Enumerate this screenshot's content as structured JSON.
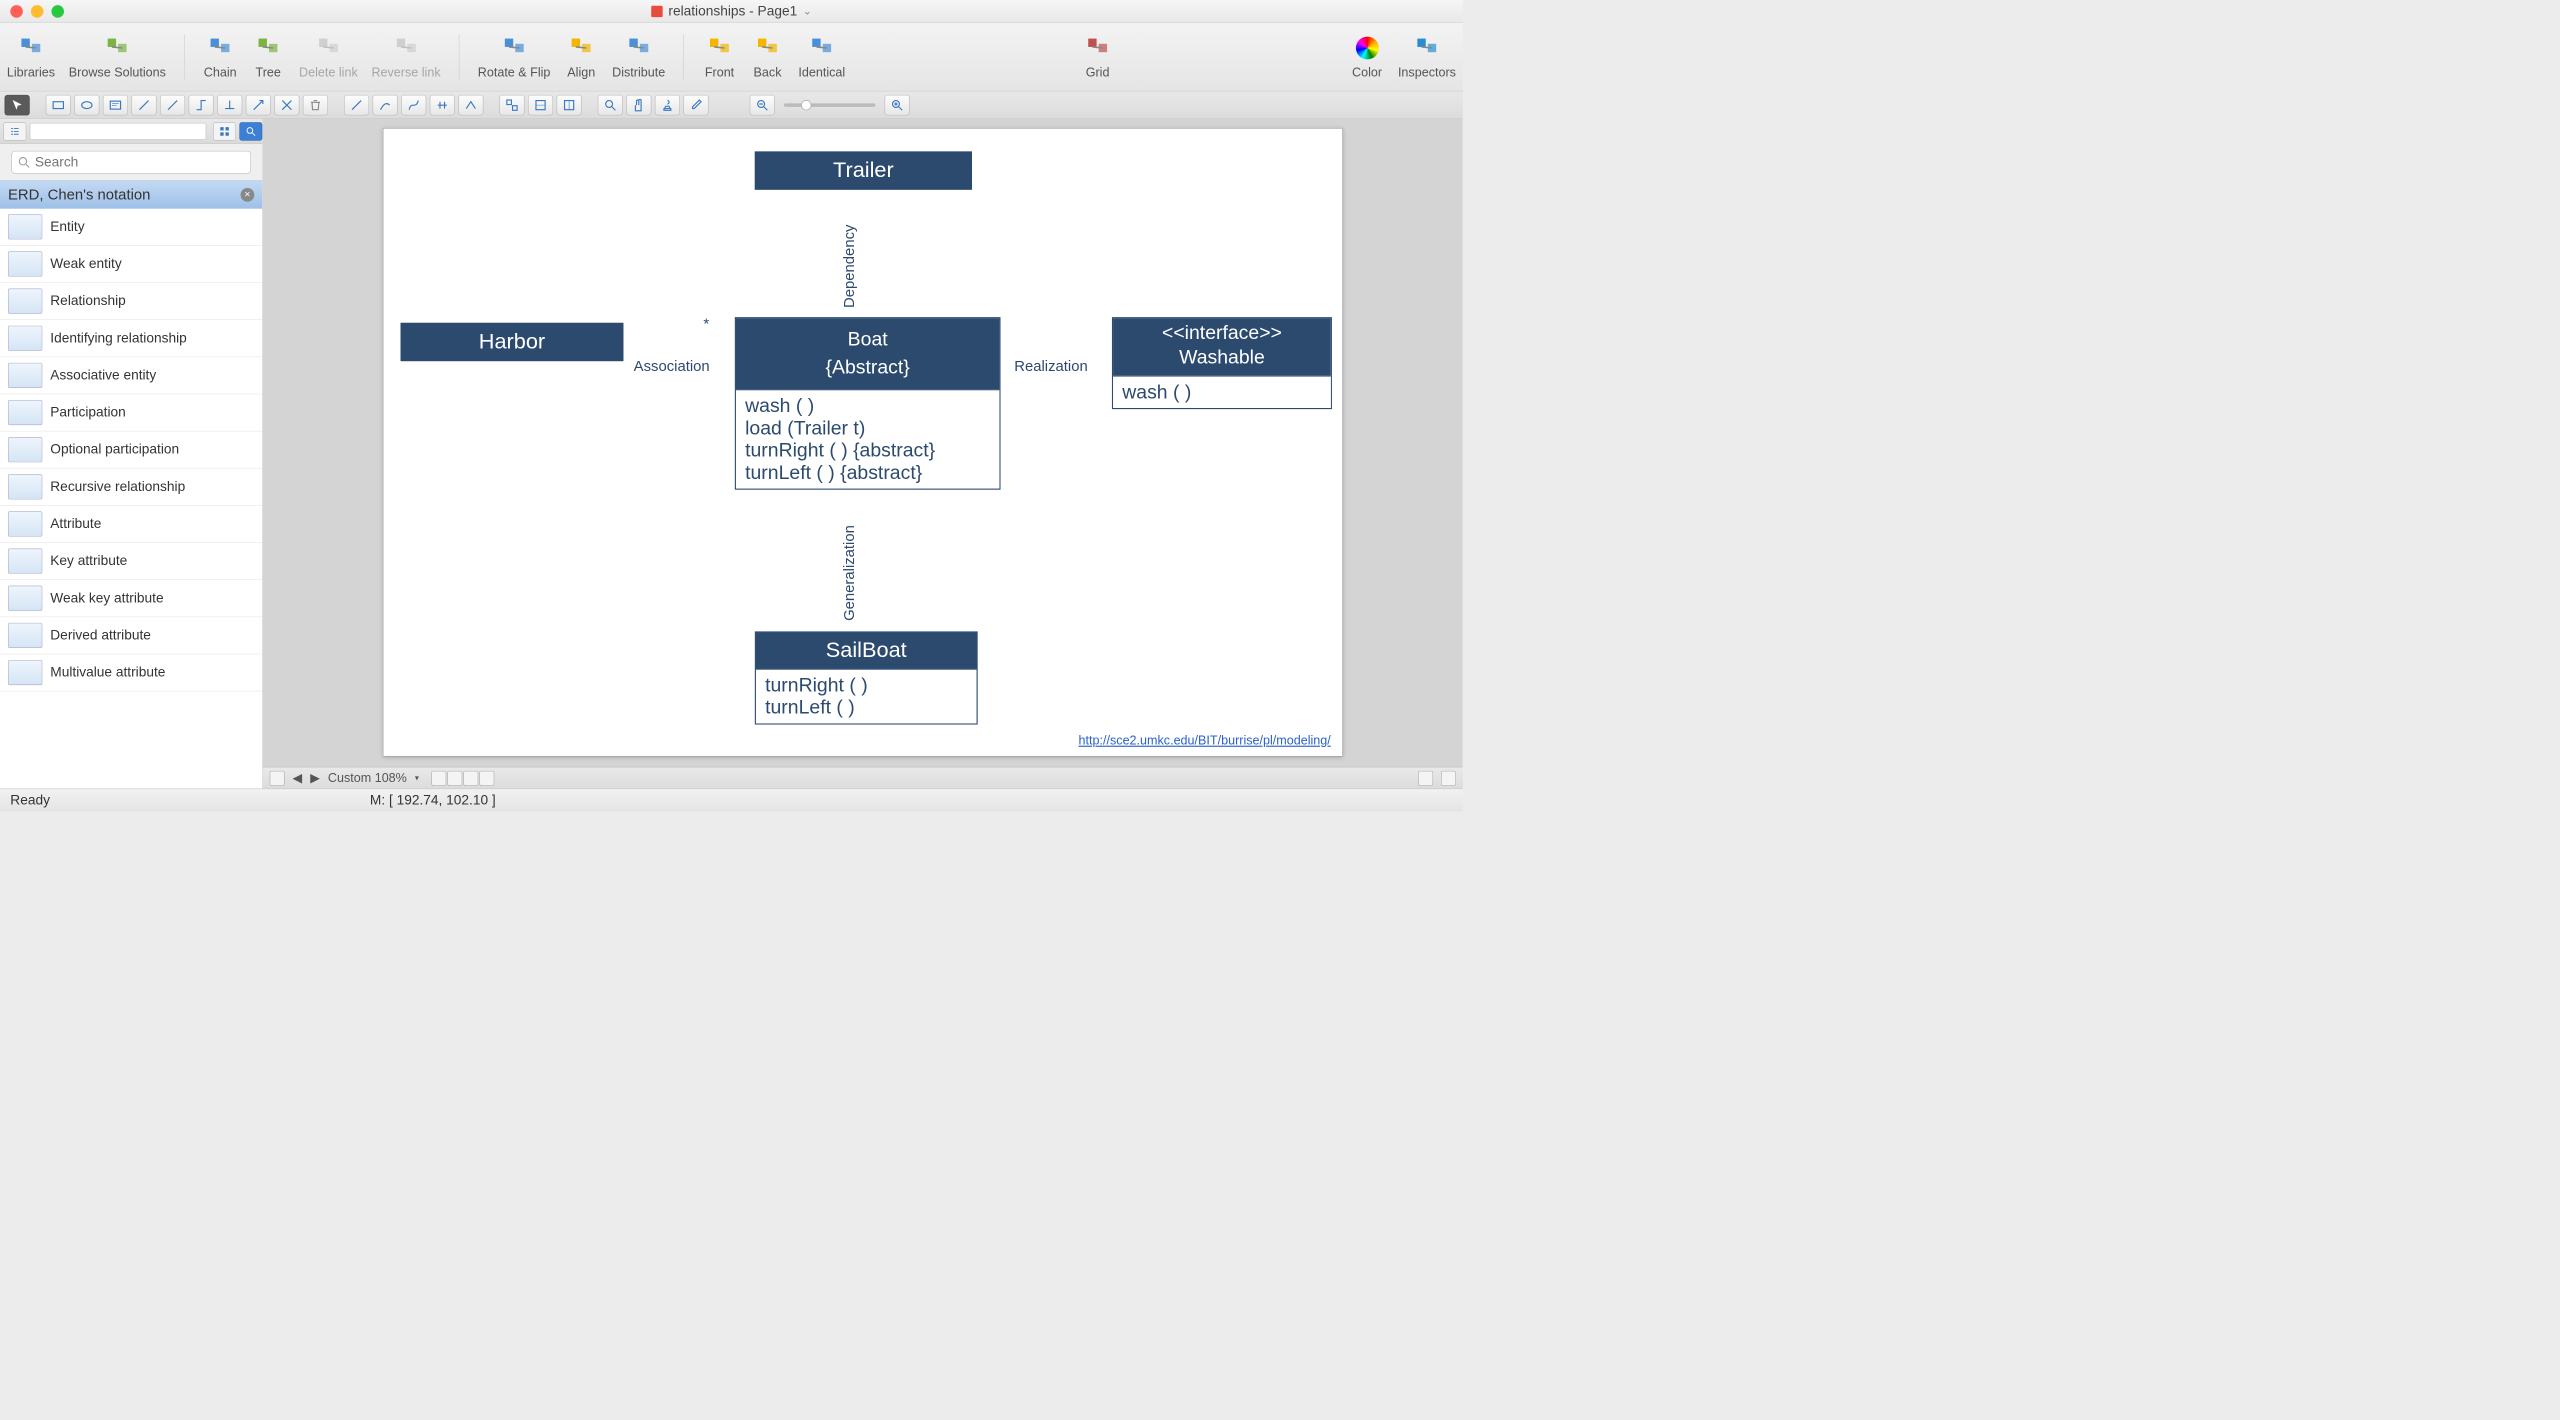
{
  "title": "relationships - Page1",
  "toolbar": [
    {
      "k": "libraries",
      "label": "Libraries",
      "icon": "#4a90d9",
      "disabled": false
    },
    {
      "k": "browse",
      "label": "Browse Solutions",
      "icon": "#7cb342",
      "disabled": false
    },
    {
      "k": "sep"
    },
    {
      "k": "chain",
      "label": "Chain",
      "icon": "#4a90d9",
      "disabled": false
    },
    {
      "k": "tree",
      "label": "Tree",
      "icon": "#7cb342",
      "disabled": false
    },
    {
      "k": "delete",
      "label": "Delete link",
      "icon": "#aaa",
      "disabled": true
    },
    {
      "k": "reverse",
      "label": "Reverse link",
      "icon": "#aaa",
      "disabled": true
    },
    {
      "k": "sep"
    },
    {
      "k": "rotate",
      "label": "Rotate & Flip",
      "icon": "#4a90d9",
      "disabled": false
    },
    {
      "k": "align",
      "label": "Align",
      "icon": "#f4b400",
      "disabled": false
    },
    {
      "k": "distribute",
      "label": "Distribute",
      "icon": "#4a90d9",
      "disabled": false
    },
    {
      "k": "sep"
    },
    {
      "k": "front",
      "label": "Front",
      "icon": "#f4b400",
      "disabled": false
    },
    {
      "k": "back",
      "label": "Back",
      "icon": "#f4b400",
      "disabled": false
    },
    {
      "k": "identical",
      "label": "Identical",
      "icon": "#4a90d9",
      "disabled": false
    },
    {
      "k": "spacer"
    },
    {
      "k": "grid",
      "label": "Grid",
      "icon": "#c0504d",
      "disabled": false
    },
    {
      "k": "spacer"
    },
    {
      "k": "color",
      "label": "Color",
      "icon": "rainbow",
      "disabled": false
    },
    {
      "k": "inspectors",
      "label": "Inspectors",
      "icon": "#2a8dd4",
      "disabled": false
    }
  ],
  "sidebar": {
    "search_placeholder": "Search",
    "category": "ERD, Chen's notation",
    "items": [
      "Entity",
      "Weak entity",
      "Relationship",
      "Identifying relationship",
      "Associative entity",
      "Participation",
      "Optional participation",
      "Recursive relationship",
      "Attribute",
      "Key attribute",
      "Weak key attribute",
      "Derived attribute",
      "Multivalue attribute"
    ]
  },
  "diagram": {
    "trailer": "Trailer",
    "harbor": "Harbor",
    "boat_name": "Boat",
    "boat_mod": "{Abstract}",
    "boat_ops": [
      "wash ( )",
      "load (Trailer t)",
      "turnRight ( ) {abstract}",
      "turnLeft ( ) {abstract}"
    ],
    "iface_stereo": "<<interface>>",
    "iface_name": "Washable",
    "iface_ops": [
      "wash ( )"
    ],
    "sailboat": "SailBoat",
    "sailboat_ops": [
      "turnRight ( )",
      "turnLeft ( )"
    ],
    "assoc": "Association",
    "star": "*",
    "dep": "Dependency",
    "gen": "Generalization",
    "real": "Realization",
    "url": "http://sce2.umkc.edu/BIT/burrise/pl/modeling/"
  },
  "bottom": {
    "zoom": "Custom 108%",
    "mouse": "M: [ 192.74, 102.10 ]",
    "status": "Ready"
  }
}
